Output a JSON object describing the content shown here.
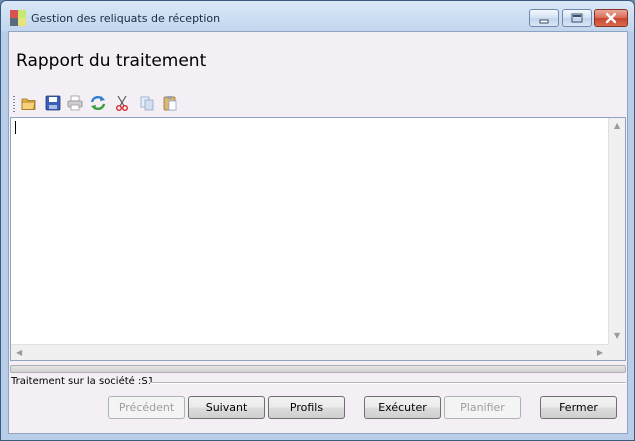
{
  "window": {
    "title": "Gestion des reliquats de réception",
    "controls": [
      "minimize-icon",
      "maximize-icon",
      "close-icon"
    ]
  },
  "page": {
    "heading": "Rapport du traitement"
  },
  "toolbar": {
    "items": [
      "folder-open-icon",
      "save-icon",
      "print-icon",
      "refresh-icon",
      "cut-icon",
      "copy-icon",
      "paste-icon"
    ]
  },
  "editor": {
    "content": ""
  },
  "status": {
    "text": "Traitement sur la société :S1"
  },
  "buttons": {
    "previous": "Précédent",
    "next": "Suivant",
    "profiles": "Profils",
    "execute": "Exécuter",
    "schedule": "Planifier",
    "close": "Fermer"
  },
  "colors": {
    "titlebar": "#c2d6ee",
    "client_bg": "#f4eff4",
    "close_button": "#c7452e"
  }
}
